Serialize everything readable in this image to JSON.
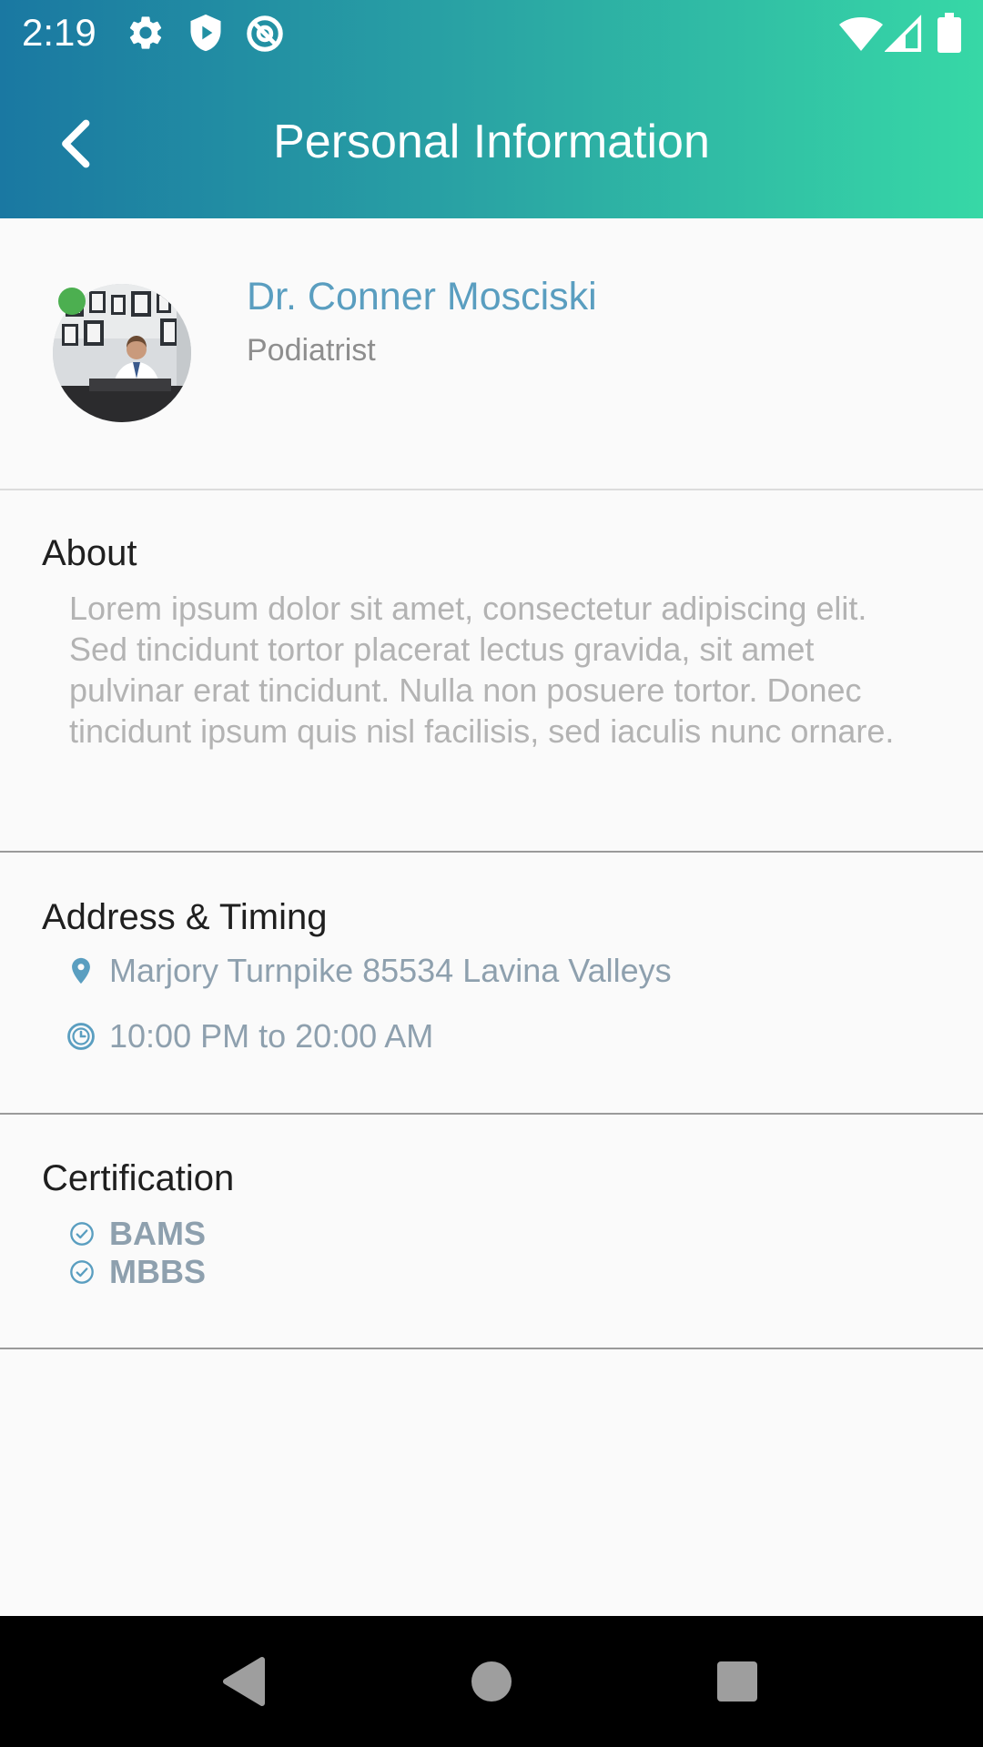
{
  "status_bar": {
    "time": "2:19",
    "icons": [
      "gear-icon",
      "shield-play-icon",
      "data-saver-icon",
      "wifi-icon",
      "signal-icon",
      "battery-icon"
    ]
  },
  "app_bar": {
    "title": "Personal Information",
    "back_icon": "chevron-left-icon",
    "gradient_start": "#1a78a2",
    "gradient_end": "#37d8a6"
  },
  "profile": {
    "name": "Dr. Conner Mosciski",
    "specialty": "Podiatrist",
    "status_color": "#4caf50"
  },
  "about": {
    "title": "About",
    "text": "Lorem ipsum dolor sit amet, consectetur adipiscing elit. Sed tincidunt tortor placerat lectus gravida, sit amet pulvinar erat tincidunt. Nulla non posuere tortor. Donec tincidunt ipsum quis nisl facilisis, sed iaculis nunc ornare."
  },
  "address_timing": {
    "title": "Address & Timing",
    "address": "Marjory Turnpike 85534 Lavina Valleys",
    "timing": "10:00 PM to 20:00 AM"
  },
  "certification": {
    "title": "Certification",
    "items": [
      "BAMS",
      "MBBS"
    ]
  },
  "nav_bar": {
    "buttons": [
      "back-triangle-icon",
      "home-circle-icon",
      "recents-square-icon"
    ]
  }
}
